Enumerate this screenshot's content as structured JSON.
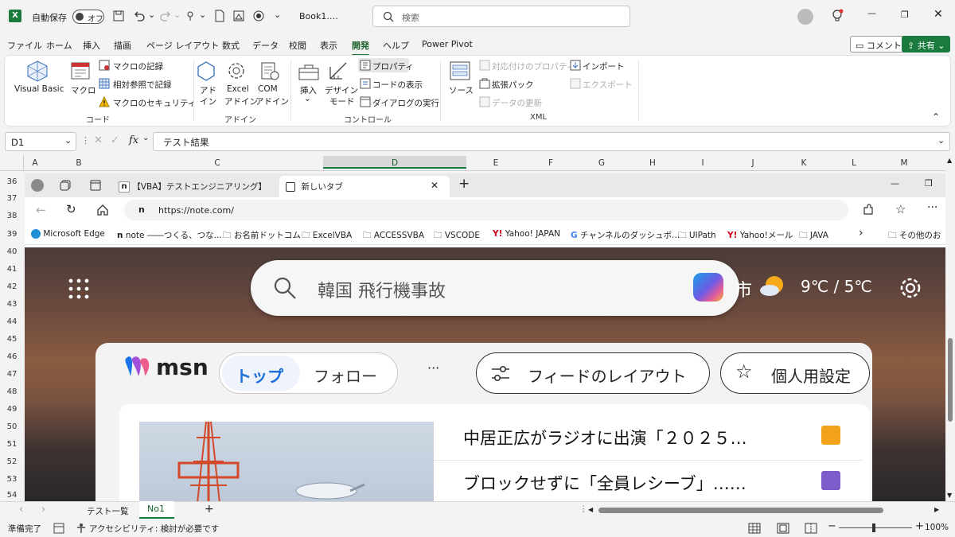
{
  "titlebar": {
    "autosave_label": "自動保存",
    "autosave_state": "オフ",
    "doc_name": "Book1.…",
    "search_placeholder": "検索"
  },
  "menu": {
    "items": [
      "ファイル",
      "ホーム",
      "挿入",
      "描画",
      "ページ レイアウト",
      "数式",
      "データ",
      "校閲",
      "表示",
      "開発",
      "ヘルプ",
      "Power Pivot"
    ],
    "active": "開発",
    "comment_label": "コメント",
    "share_label": "共有"
  },
  "ribbon": {
    "code": {
      "visual_basic": "Visual Basic",
      "macro": "マクロ",
      "record_macro": "マクロの記録",
      "relative_ref": "相対参照で記録",
      "macro_security": "マクロのセキュリティ",
      "group_label": "コード"
    },
    "addins": {
      "addin_1": "アド",
      "addin_2": "イン",
      "excel_addin_1": "Excel",
      "excel_addin_2": "アドイン",
      "com_addin_1": "COM",
      "com_addin_2": "アドイン",
      "group_label": "アドイン"
    },
    "controls": {
      "insert": "挿入",
      "insert_arrow": "⌄",
      "design_mode_1": "デザイン",
      "design_mode_2": "モード",
      "properties": "プロパティ",
      "view_code": "コードの表示",
      "run_dialog": "ダイアログの実行",
      "group_label": "コントロール"
    },
    "xml": {
      "source": "ソース",
      "map_properties": "対応付けのプロパティ",
      "expansion_packs": "拡張パック",
      "refresh_data": "データの更新",
      "import": "インポート",
      "export": "エクスポート",
      "group_label": "XML"
    }
  },
  "formula_bar": {
    "name_box": "D1",
    "fx": "fx",
    "content": "テスト結果"
  },
  "columns": [
    "A",
    "B",
    "C",
    "D",
    "E",
    "F",
    "G",
    "H",
    "I",
    "J",
    "K",
    "L",
    "M"
  ],
  "rows": [
    "36",
    "37",
    "38",
    "39",
    "40",
    "41",
    "42",
    "43",
    "44",
    "45",
    "46",
    "47",
    "48",
    "49",
    "50",
    "51",
    "52",
    "53",
    "54"
  ],
  "browser": {
    "tab1_title": "【VBA】テストエンジニアリング】エビデ",
    "tab2_title": "新しいタブ",
    "url": "https://note.com/",
    "bookmarks": [
      "Microsoft Edge",
      "note ――つくる、つな...",
      "お名前ドットコム",
      "ExcelVBA",
      "ACCESSVBA",
      "VSCODE",
      "Yahoo! JAPAN",
      "チャンネルのダッシュボ...",
      "UIPath",
      "Yahoo!メール",
      "JAVA",
      "その他のお"
    ],
    "msn": {
      "search_text": "韓国 飛行機事故",
      "location_suffix": "市",
      "weather": "9℃ / 5℃",
      "logo": "msn",
      "tab_top": "トップ",
      "tab_follow": "フォロー",
      "more": "···",
      "feed_layout": "フィードのレイアウト",
      "personalize": "個人用設定",
      "headline_1": "中居正広がラジオに出演「２０２５…",
      "headline_2": "ブロックせずに「全員レシーブ」……"
    }
  },
  "sheets": {
    "tabs": [
      "テスト一覧",
      "No1"
    ],
    "active": "No1",
    "add": "+"
  },
  "status": {
    "ready": "準備完了",
    "accessibility": "アクセシビリティ: 検討が必要です",
    "zoom": "100%"
  },
  "colors": {
    "excel_green": "#1b7a3e",
    "accent_blue": "#1a6fd8"
  }
}
